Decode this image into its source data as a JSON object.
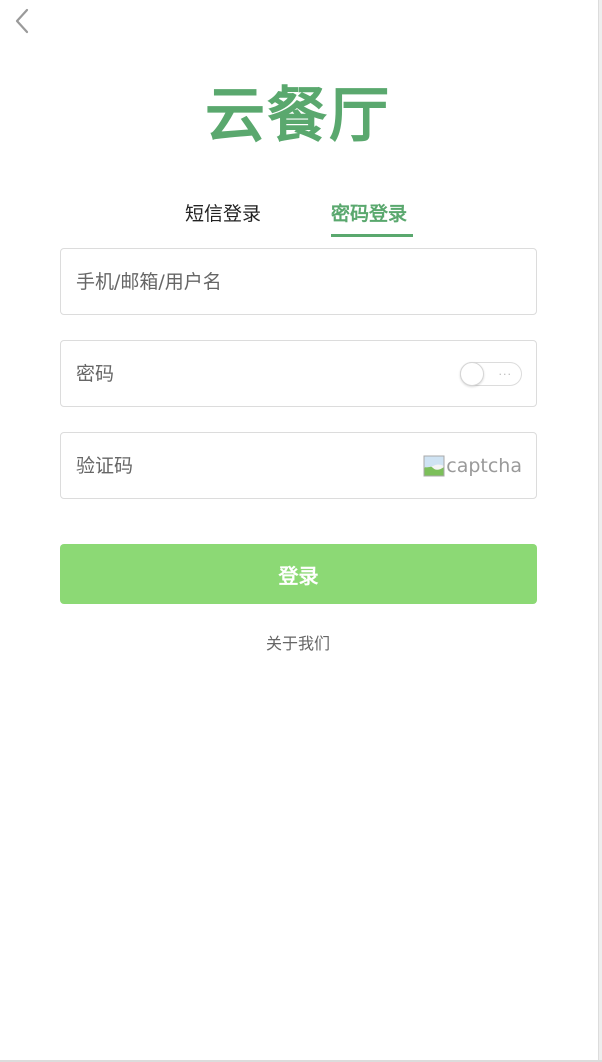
{
  "colors": {
    "brand_green": "#5aa86e",
    "button_green": "#8cd975",
    "border": "#dcdcdc",
    "placeholder": "#666666",
    "about_text": "#666666"
  },
  "header": {
    "back_icon": "chevron-left-icon"
  },
  "app": {
    "title": "云餐厅"
  },
  "tabs": [
    {
      "label": "短信登录",
      "active": false
    },
    {
      "label": "密码登录",
      "active": true
    }
  ],
  "form": {
    "account": {
      "placeholder": "手机/邮箱/用户名",
      "value": ""
    },
    "password": {
      "placeholder": "密码",
      "value": "",
      "visibility_toggle": {
        "state": "off",
        "label": "..."
      }
    },
    "captcha": {
      "placeholder": "验证码",
      "value": "",
      "image_alt": "captcha",
      "image_icon": "broken-image-icon"
    }
  },
  "actions": {
    "login_label": "登录",
    "about_label": "关于我们"
  }
}
